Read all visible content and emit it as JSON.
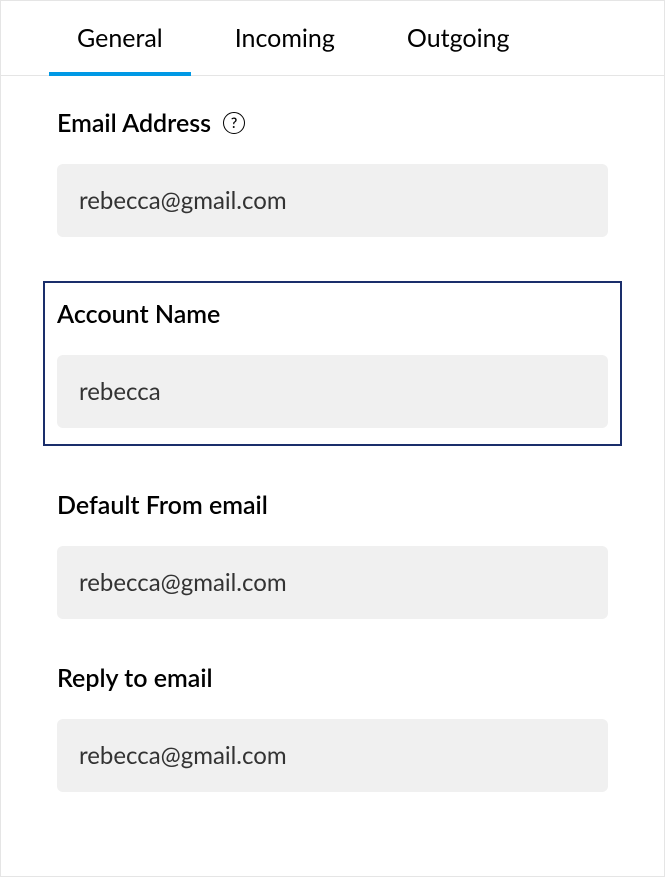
{
  "tabs": {
    "general": "General",
    "incoming": "Incoming",
    "outgoing": "Outgoing"
  },
  "fields": {
    "email_address": {
      "label": "Email Address",
      "value": "rebecca@gmail.com"
    },
    "account_name": {
      "label": "Account Name",
      "value": "rebecca"
    },
    "default_from": {
      "label": "Default From email",
      "value": "rebecca@gmail.com"
    },
    "reply_to": {
      "label": "Reply to email",
      "value": "rebecca@gmail.com"
    }
  },
  "help_icon_glyph": "?"
}
